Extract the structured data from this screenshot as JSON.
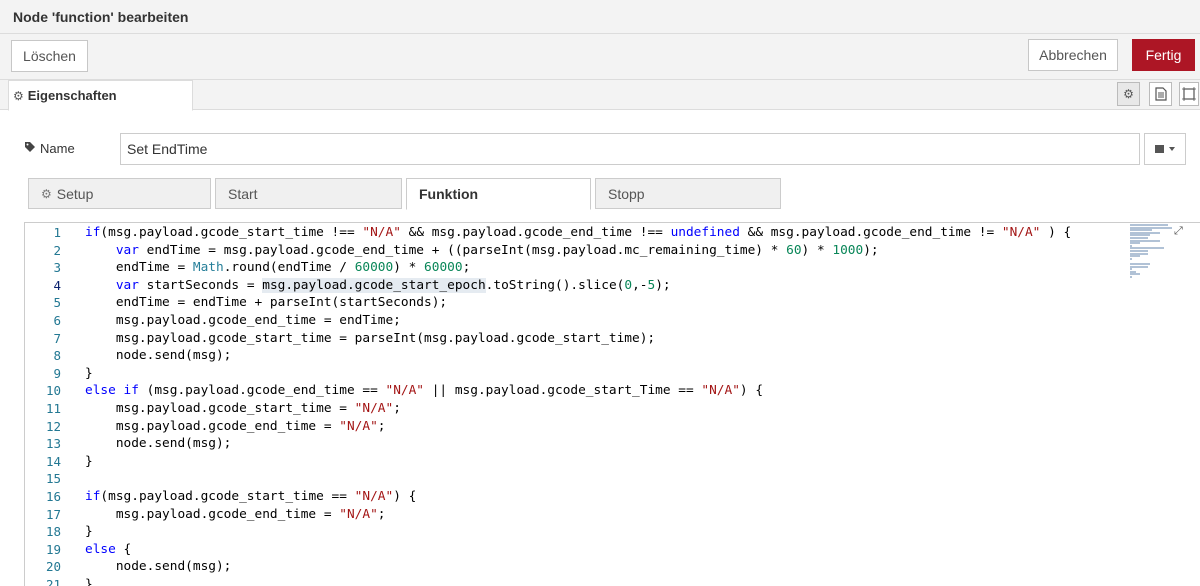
{
  "title": "Node 'function' bearbeiten",
  "actions": {
    "delete": "Löschen",
    "cancel": "Abbrechen",
    "done": "Fertig"
  },
  "tabs": {
    "properties": "Eigenschaften"
  },
  "name_field": {
    "label": "Name",
    "value": "Set EndTime"
  },
  "func_tabs": [
    "Setup",
    "Start",
    "Funktion",
    "Stopp"
  ],
  "icons": {
    "props_tab": "gear-icon",
    "name_label": "tag-icon",
    "setup_tab": "gear-icon",
    "side_1": "gear-icon",
    "side_2": "document-icon",
    "side_3": "frame-icon",
    "name_btn": "book-dropdown-icon",
    "expand": "expand-icon"
  },
  "colors": {
    "accent": "#ad1625",
    "keyword": "#0000ff",
    "string": "#a31515",
    "number": "#098658",
    "type": "#267f99",
    "line_number": "#237893"
  },
  "code": {
    "line_numbers": [
      "1",
      "2",
      "3",
      "4",
      "5",
      "6",
      "7",
      "8",
      "9",
      "10",
      "11",
      "12",
      "13",
      "14",
      "15",
      "16",
      "17",
      "18",
      "19",
      "20",
      "21"
    ],
    "current_line": 4,
    "lines": [
      [
        [
          "kw",
          "if"
        ],
        [
          "",
          "(msg.payload.gcode_start_time !== "
        ],
        [
          "str",
          "\"N/A\""
        ],
        [
          "",
          " && msg.payload.gcode_end_time !== "
        ],
        [
          "kw",
          "undefined"
        ],
        [
          "",
          " && msg.payload.gcode_end_time != "
        ],
        [
          "str",
          "\"N/A\""
        ],
        [
          "",
          " ) {"
        ]
      ],
      [
        [
          "",
          "    "
        ],
        [
          "kw",
          "var"
        ],
        [
          "",
          " endTime = msg.payload.gcode_end_time + ((parseInt(msg.payload.mc_remaining_time) * "
        ],
        [
          "num",
          "60"
        ],
        [
          "",
          ") * "
        ],
        [
          "num",
          "1000"
        ],
        [
          "",
          ");"
        ]
      ],
      [
        [
          "",
          "    endTime = "
        ],
        [
          "typ",
          "Math"
        ],
        [
          "",
          ".round(endTime / "
        ],
        [
          "num",
          "60000"
        ],
        [
          "",
          ") * "
        ],
        [
          "num",
          "60000"
        ],
        [
          "",
          ";"
        ]
      ],
      [
        [
          "",
          "    "
        ],
        [
          "kw",
          "var"
        ],
        [
          "",
          " startSeconds = "
        ],
        [
          "hl",
          "msg.payload.gcode_start_epoch"
        ],
        [
          "",
          ".toString().slice("
        ],
        [
          "num",
          "0"
        ],
        [
          "",
          ",-"
        ],
        [
          "num",
          "5"
        ],
        [
          "",
          ");"
        ]
      ],
      [
        [
          "",
          "    endTime = endTime + parseInt(startSeconds);"
        ]
      ],
      [
        [
          "",
          "    msg.payload.gcode_end_time = endTime;"
        ]
      ],
      [
        [
          "",
          "    msg.payload.gcode_start_time = parseInt(msg.payload.gcode_start_time);"
        ]
      ],
      [
        [
          "",
          "    node.send(msg);"
        ]
      ],
      [
        [
          "",
          "}"
        ]
      ],
      [
        [
          "kw",
          "else if"
        ],
        [
          "",
          " (msg.payload.gcode_end_time == "
        ],
        [
          "str",
          "\"N/A\""
        ],
        [
          "",
          " || msg.payload.gcode_start_Time == "
        ],
        [
          "str",
          "\"N/A\""
        ],
        [
          "",
          ") {"
        ]
      ],
      [
        [
          "",
          "    msg.payload.gcode_start_time = "
        ],
        [
          "str",
          "\"N/A\""
        ],
        [
          "",
          ";"
        ]
      ],
      [
        [
          "",
          "    msg.payload.gcode_end_time = "
        ],
        [
          "str",
          "\"N/A\""
        ],
        [
          "",
          ";"
        ]
      ],
      [
        [
          "",
          "    node.send(msg);"
        ]
      ],
      [
        [
          "",
          "}"
        ]
      ],
      [
        [
          "",
          ""
        ]
      ],
      [
        [
          "kw",
          "if"
        ],
        [
          "",
          "(msg.payload.gcode_start_time == "
        ],
        [
          "str",
          "\"N/A\""
        ],
        [
          "",
          ") {"
        ]
      ],
      [
        [
          "",
          "    msg.payload.gcode_end_time = "
        ],
        [
          "str",
          "\"N/A\""
        ],
        [
          "",
          ";"
        ]
      ],
      [
        [
          "",
          "}"
        ]
      ],
      [
        [
          "kw",
          "else"
        ],
        [
          "",
          " {"
        ]
      ],
      [
        [
          "",
          "    node.send(msg);"
        ]
      ],
      [
        [
          "",
          "}"
        ]
      ]
    ]
  }
}
